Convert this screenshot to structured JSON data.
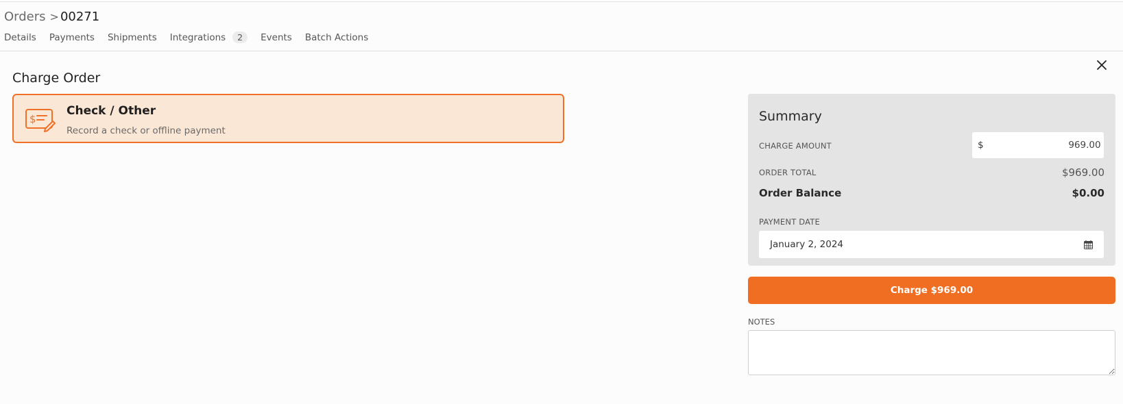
{
  "breadcrumb": {
    "parent": "Orders",
    "separator": ">",
    "current": "00271"
  },
  "tabs": [
    {
      "label": "Details"
    },
    {
      "label": "Payments"
    },
    {
      "label": "Shipments"
    },
    {
      "label": "Integrations",
      "badge": "2"
    },
    {
      "label": "Events"
    },
    {
      "label": "Batch Actions"
    }
  ],
  "section": {
    "title": "Charge Order"
  },
  "payment_method": {
    "title": "Check / Other",
    "description": "Record a check or offline payment",
    "icon": "check-payment-icon"
  },
  "summary": {
    "title": "Summary",
    "charge_amount_label": "CHARGE AMOUNT",
    "currency_symbol": "$",
    "charge_amount_value": "969.00",
    "order_total_label": "ORDER TOTAL",
    "order_total_value": "$969.00",
    "order_balance_label": "Order Balance",
    "order_balance_value": "$0.00",
    "payment_date_label": "PAYMENT DATE",
    "payment_date_value": "January 2, 2024"
  },
  "charge_button": {
    "label": "Charge $969.00"
  },
  "notes": {
    "label": "NOTES",
    "value": ""
  },
  "colors": {
    "accent": "#f06e22",
    "accent_light": "#fbe7d6",
    "summary_bg": "#e4e4e5"
  }
}
